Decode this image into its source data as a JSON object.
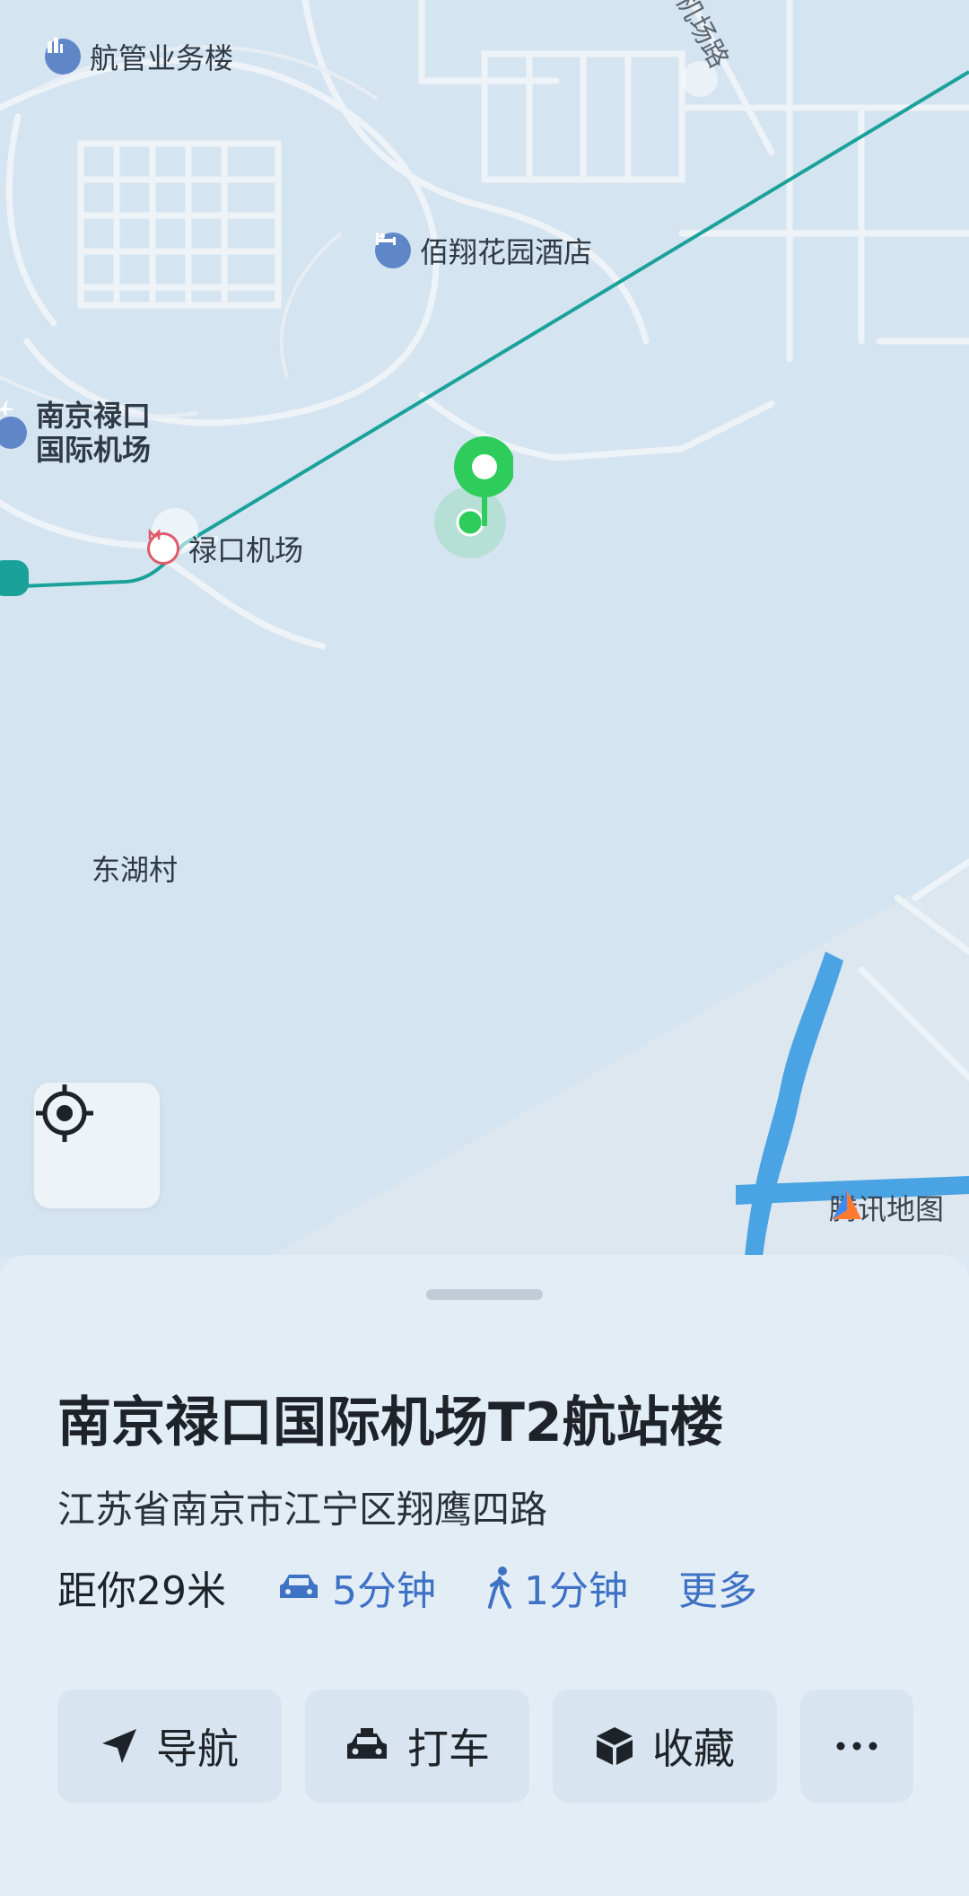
{
  "map": {
    "labels": {
      "aviation_building": "航管业务楼",
      "hotel": "佰翔花园酒店",
      "airport": "南京禄口国际机场",
      "airport_line1": "南京禄口",
      "airport_line2": "国际机场",
      "metro_station": "禄口机场",
      "village": "东湖村",
      "road": "机场路"
    },
    "brand": "腾讯地图",
    "colors": {
      "metro_line": "#1aa29a",
      "pin": "#2ecc5a",
      "water": "#4aa3e2",
      "road": "#eef3f8"
    }
  },
  "locate_button": {
    "icon": "crosshair-icon"
  },
  "place": {
    "name": "南京禄口国际机场T2航站楼",
    "address": "江苏省南京市江宁区翔鹰四路",
    "distance": "距你29米",
    "drive_time": "5分钟",
    "walk_time": "1分钟",
    "more": "更多"
  },
  "actions": {
    "navigate": "导航",
    "taxi": "打车",
    "favorite": "收藏",
    "more_icon": "ellipsis-icon"
  }
}
